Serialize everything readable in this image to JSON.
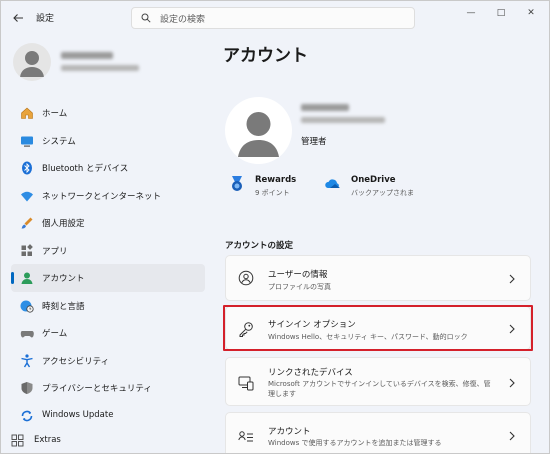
{
  "titlebar": {
    "title": "設定",
    "search_placeholder": "設定の検索",
    "back_icon": "back-arrow-icon",
    "minimize_glyph": "—",
    "maximize_glyph": "□",
    "close_glyph": "✕"
  },
  "sidebar": {
    "items": [
      {
        "label": "ホーム",
        "icon": "home-icon",
        "active": false
      },
      {
        "label": "システム",
        "icon": "system-icon",
        "active": false
      },
      {
        "label": "Bluetooth とデバイス",
        "icon": "bluetooth-icon",
        "active": false
      },
      {
        "label": "ネットワークとインターネット",
        "icon": "wifi-icon",
        "active": false
      },
      {
        "label": "個人用設定",
        "icon": "brush-icon",
        "active": false
      },
      {
        "label": "アプリ",
        "icon": "apps-icon",
        "active": false
      },
      {
        "label": "アカウント",
        "icon": "account-icon",
        "active": true
      },
      {
        "label": "時刻と言語",
        "icon": "globe-clock-icon",
        "active": false
      },
      {
        "label": "ゲーム",
        "icon": "gamepad-icon",
        "active": false
      },
      {
        "label": "アクセシビリティ",
        "icon": "accessibility-icon",
        "active": false
      },
      {
        "label": "プライバシーとセキュリティ",
        "icon": "shield-icon",
        "active": false
      },
      {
        "label": "Windows Update",
        "icon": "update-icon",
        "active": false
      }
    ],
    "extras_label": "Extras"
  },
  "main": {
    "title": "アカウント",
    "account_role": "管理者",
    "services": [
      {
        "title": "Rewards",
        "subtitle": "9 ポイント",
        "icon": "rewards-icon"
      },
      {
        "title": "OneDrive",
        "subtitle": "バックアップされま",
        "icon": "onedrive-icon"
      }
    ],
    "section_label": "アカウントの設定",
    "cards": [
      {
        "title": "ユーザーの情報",
        "subtitle": "プロファイルの写真",
        "icon": "user-info-icon"
      },
      {
        "title": "サインイン オプション",
        "subtitle": "Windows Hello、セキュリティ キー、パスワード、動的ロック",
        "icon": "key-icon"
      },
      {
        "title": "リンクされたデバイス",
        "subtitle": "Microsoft アカウントでサインインしているデバイスを検索、修復、管理します",
        "icon": "linked-devices-icon"
      },
      {
        "title": "アカウント",
        "subtitle": "Windows で使用するアカウントを追加または管理する",
        "icon": "accounts-list-icon"
      }
    ]
  },
  "colors": {
    "accent": "#0067c0",
    "highlight": "#d4202a",
    "background": "#f0f3f9"
  }
}
